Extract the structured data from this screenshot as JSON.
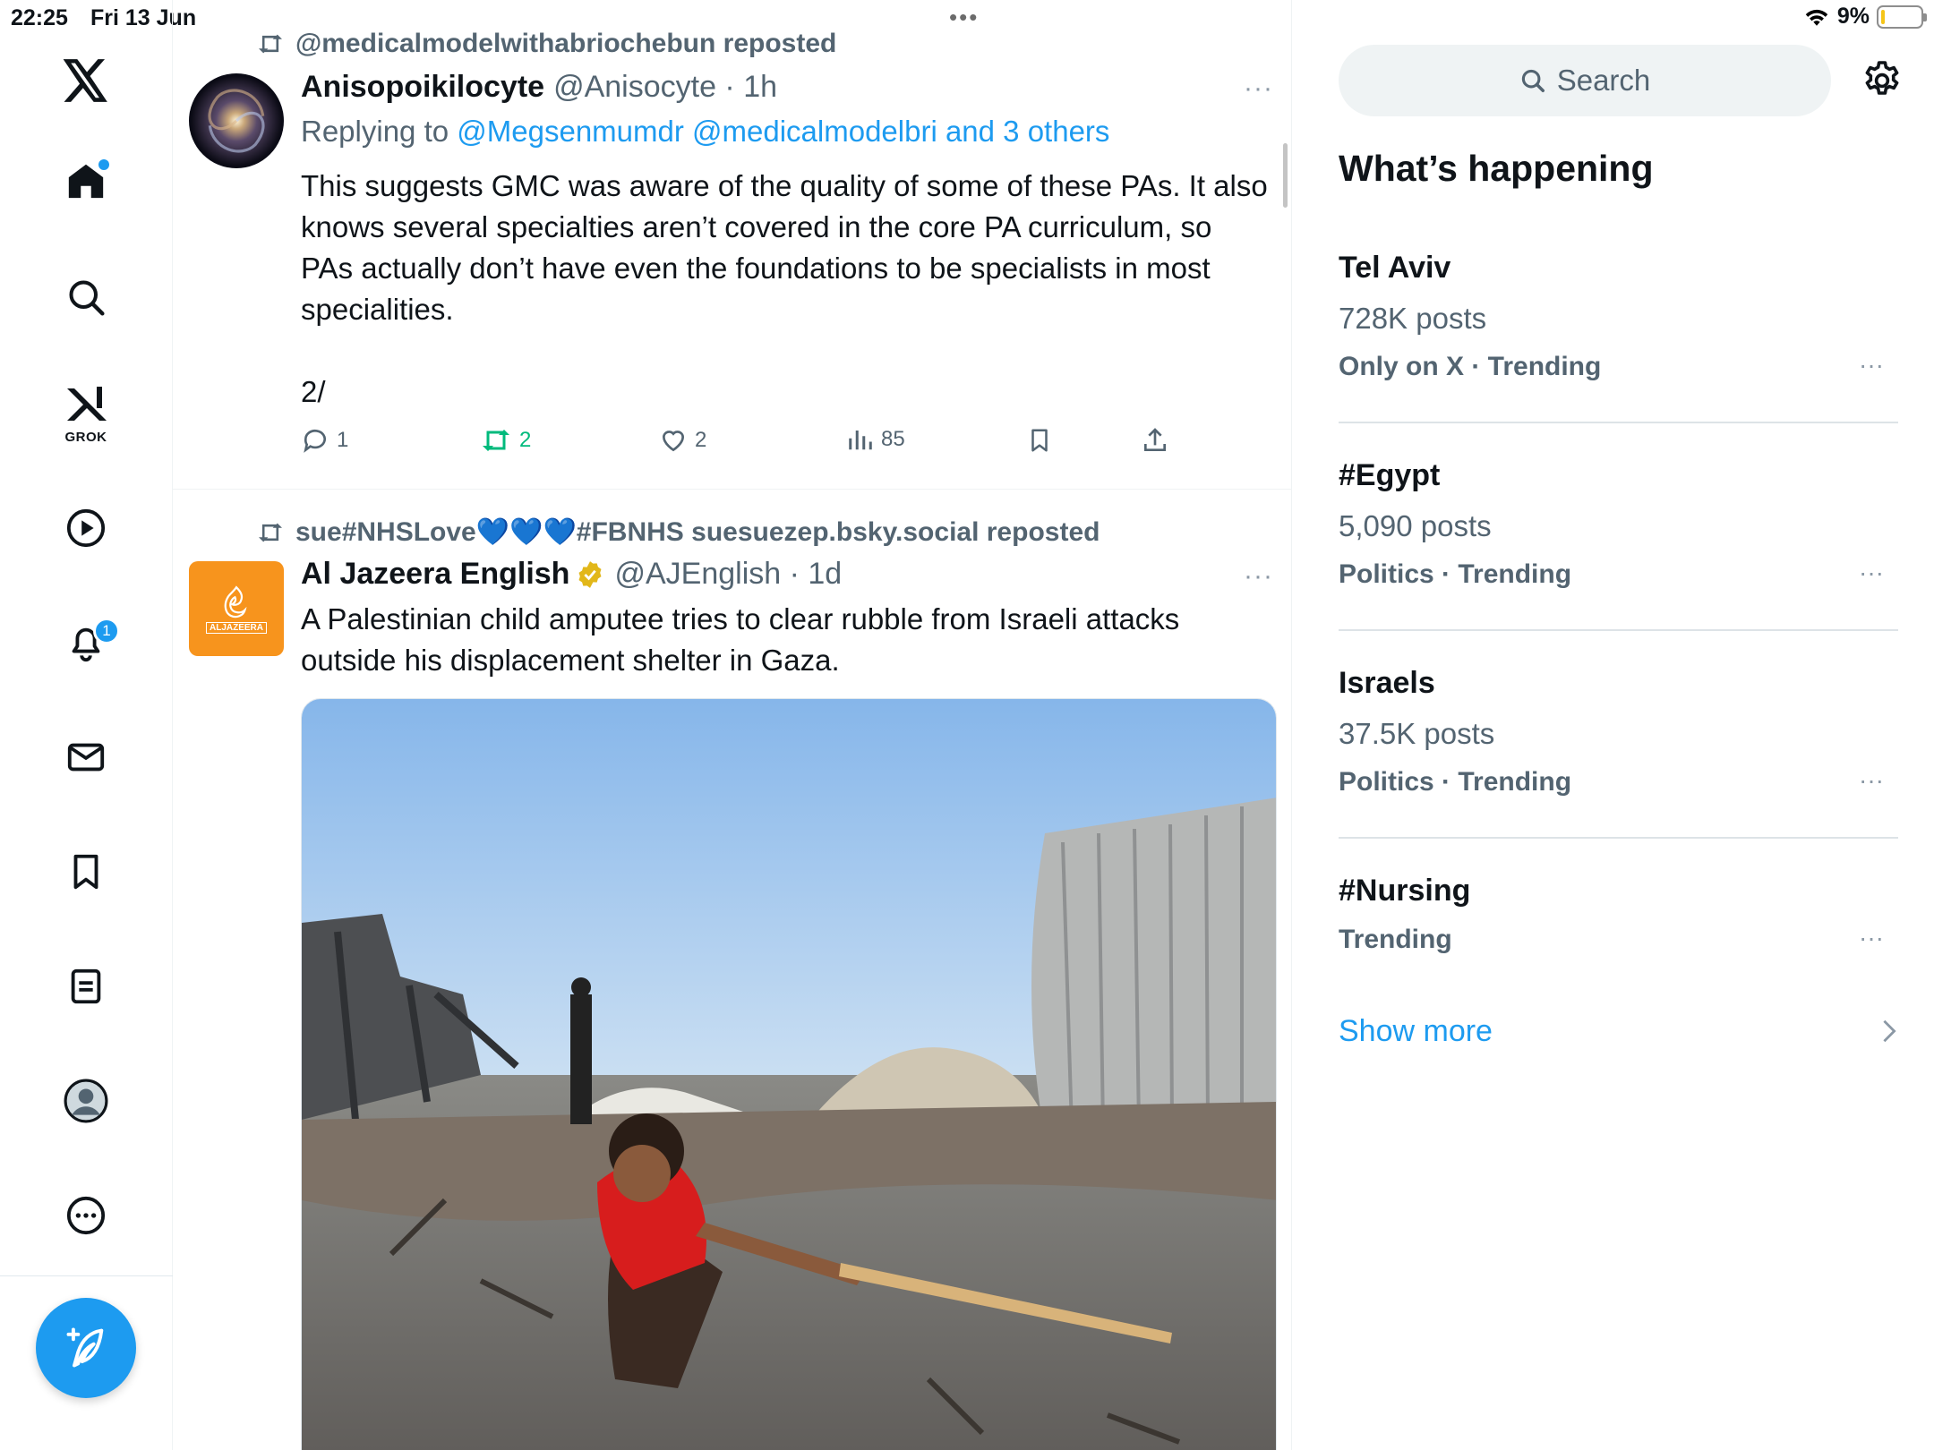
{
  "status_bar": {
    "time": "22:25",
    "date": "Fri 13 Jun",
    "battery": "9%",
    "battery_level": 0.09
  },
  "nav": {
    "items": [
      "x-logo",
      "home",
      "search",
      "grok",
      "video",
      "notifications",
      "messages",
      "bookmarks",
      "lists",
      "profile",
      "more"
    ],
    "grok_label": "GROK",
    "notifications_badge": "1"
  },
  "feed": {
    "posts": [
      {
        "repost_by": "@medicalmodelwithabriochebun reposted",
        "author_name": "Anisopoikilocyte",
        "handle_time": "@Anisocyte · 1h",
        "replying_prefix": "Replying to",
        "replying_links": "@Megsenmumdr @medicalmodelbri and 3 others",
        "text": "This suggests GMC was aware of the quality of some of these PAs. It also knows several specialties aren’t covered in the core PA curriculum, so PAs actually don’t have even the foundations to be specialists in most specialities.",
        "text_suffix": "2/",
        "replies": "1",
        "reposts": "2",
        "likes": "2",
        "views": "85"
      },
      {
        "repost_by": "sue#NHSLove💙💙💙#FBNHS suesuezep.bsky.social reposted",
        "author_name": "Al Jazeera English",
        "handle_time": "@AJEnglish · 1d",
        "avatar_text": "ALJAZEERA",
        "text": "A Palestinian child amputee tries to clear rubble from Israeli attacks outside his displacement shelter in Gaza."
      }
    ],
    "more_label": "···"
  },
  "sidebar": {
    "search_placeholder": "Search",
    "title": "What’s happening",
    "trends": [
      {
        "name": "Tel Aviv",
        "count": "728K posts",
        "meta": "Only on X · Trending"
      },
      {
        "name": "#Egypt",
        "count": "5,090 posts",
        "meta": "Politics · Trending"
      },
      {
        "name": "Israels",
        "count": "37.5K posts",
        "meta": "Politics · Trending"
      },
      {
        "name": "#Nursing",
        "count": "",
        "meta": "Trending"
      }
    ],
    "show_more": "Show more"
  },
  "colors": {
    "accent": "#1d9bf0",
    "repost_green": "#00ba7c",
    "text_secondary": "#536471"
  }
}
